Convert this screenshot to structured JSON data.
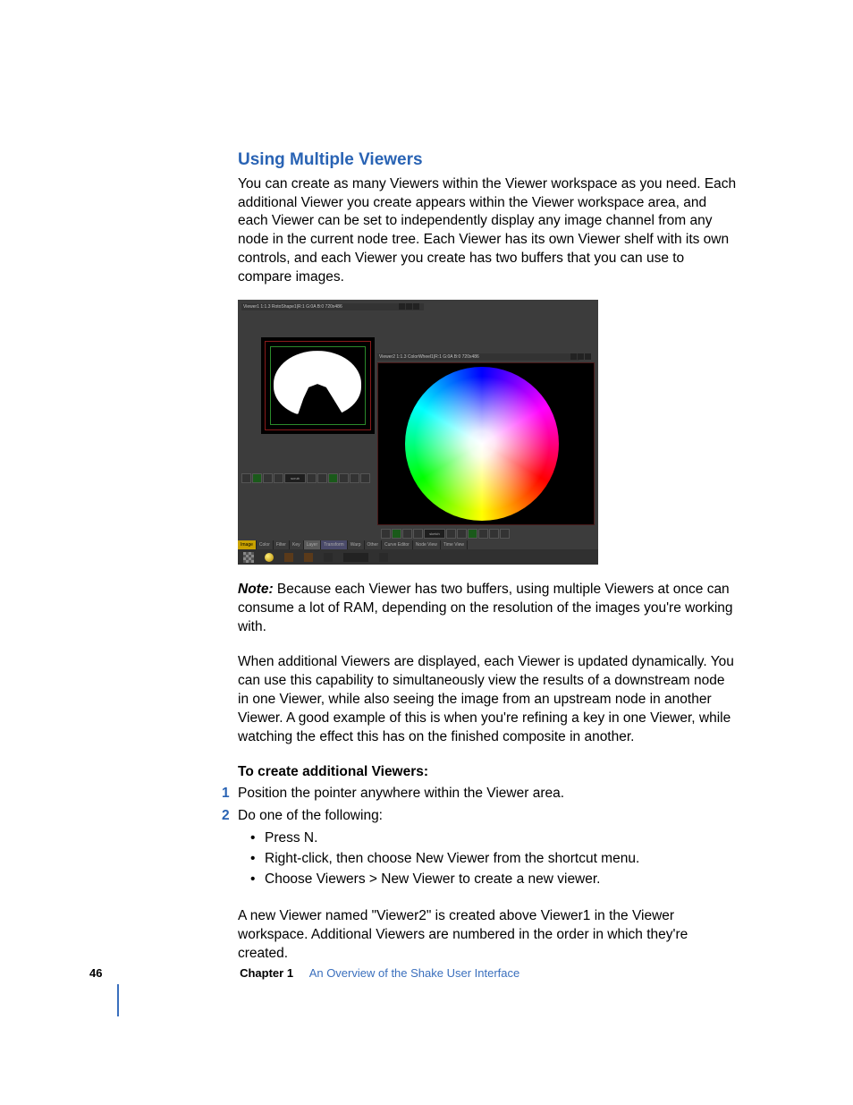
{
  "heading": "Using Multiple Viewers",
  "intro": "You can create as many Viewers within the Viewer workspace as you need. Each additional Viewer you create appears within the Viewer workspace area, and each Viewer can be set to independently display any image channel from any node in the current node tree. Each Viewer has its own Viewer shelf with its own controls, and each Viewer you create has two buffers that you can use to compare images.",
  "screenshot": {
    "viewer1_title": "Viewer1 1:1.3 RotoShape1|R:1 G:0A B:0 720x486",
    "viewer2_title": "Viewer2 1:1.3 ColorWheel1|R:1 G:0A B:0 720x486",
    "shelf_label_1": "scrub",
    "shelf_label_2": "sketch",
    "tabs": [
      "Image",
      "Color",
      "Filter",
      "Key",
      "Layer",
      "Transform",
      "Warp",
      "Other",
      "Curve Editor",
      "Node View",
      "Time View"
    ]
  },
  "note_label": "Note:",
  "note_body": "  Because each Viewer has two buffers, using multiple Viewers at once can consume a lot of RAM, depending on the resolution of the images you're working with.",
  "para2": "When additional Viewers are displayed, each Viewer is updated dynamically. You can use this capability to simultaneously view the results of a downstream node in one Viewer, while also seeing the image from an upstream node in another Viewer. A good example of this is when you're refining a key in one Viewer, while watching the effect this has on the finished composite in another.",
  "steps_heading": "To create additional Viewers:",
  "step1_num": "1",
  "step1": "Position the pointer anywhere within the Viewer area.",
  "step2_num": "2",
  "step2": "Do one of the following:",
  "bullets": {
    "b1": "Press N.",
    "b2": "Right-click, then choose New Viewer from the shortcut menu.",
    "b3": "Choose Viewers > New Viewer to create a new viewer."
  },
  "closing": "A new Viewer named \"Viewer2\" is created above Viewer1 in the Viewer workspace. Additional Viewers are numbered in the order in which they're created.",
  "footer": {
    "page": "46",
    "chapter_label": "Chapter 1",
    "chapter_title": "An Overview of the Shake User Interface"
  }
}
